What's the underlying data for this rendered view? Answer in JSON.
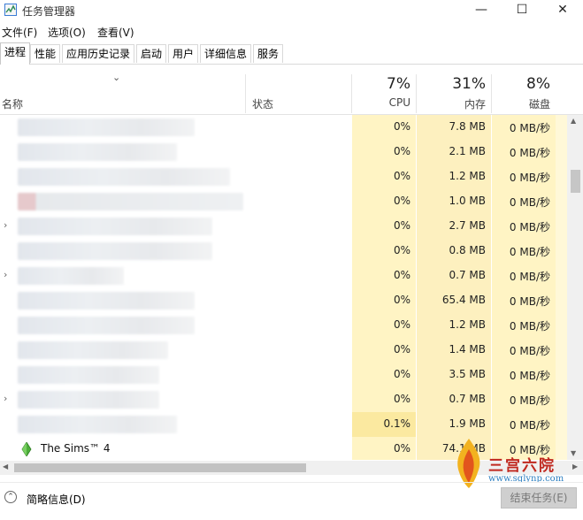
{
  "window": {
    "title": "任务管理器",
    "icon": "task-manager-icon"
  },
  "window_controls": {
    "minimize": "—",
    "maximize": "☐",
    "close": "✕"
  },
  "menu": [
    "文件(F)",
    "选项(O)",
    "查看(V)"
  ],
  "tabs": [
    "进程",
    "性能",
    "应用历史记录",
    "启动",
    "用户",
    "详细信息",
    "服务"
  ],
  "active_tab": "进程",
  "columns": {
    "name": "名称",
    "status": "状态",
    "cpu": {
      "pct": "7%",
      "label": "CPU"
    },
    "memory": {
      "pct": "31%",
      "label": "内存"
    },
    "disk": {
      "pct": "8%",
      "label": "磁盘"
    }
  },
  "rows": [
    {
      "name": "",
      "cpu": "0%",
      "mem": "7.8 MB",
      "disk": "0 MB/秒",
      "expander": false
    },
    {
      "name": "",
      "cpu": "0%",
      "mem": "2.1 MB",
      "disk": "0 MB/秒",
      "expander": false
    },
    {
      "name": "",
      "cpu": "0%",
      "mem": "1.2 MB",
      "disk": "0 MB/秒",
      "expander": false
    },
    {
      "name": "",
      "cpu": "0%",
      "mem": "1.0 MB",
      "disk": "0 MB/秒",
      "expander": false
    },
    {
      "name": "",
      "cpu": "0%",
      "mem": "2.7 MB",
      "disk": "0 MB/秒",
      "expander": true
    },
    {
      "name": "",
      "cpu": "0%",
      "mem": "0.8 MB",
      "disk": "0 MB/秒",
      "expander": false
    },
    {
      "name": "",
      "cpu": "0%",
      "mem": "0.7 MB",
      "disk": "0 MB/秒",
      "expander": true
    },
    {
      "name": "",
      "cpu": "0%",
      "mem": "65.4 MB",
      "disk": "0 MB/秒",
      "expander": false
    },
    {
      "name": "",
      "cpu": "0%",
      "mem": "1.2 MB",
      "disk": "0 MB/秒",
      "expander": false
    },
    {
      "name": "",
      "cpu": "0%",
      "mem": "1.4 MB",
      "disk": "0 MB/秒",
      "expander": false
    },
    {
      "name": "",
      "cpu": "0%",
      "mem": "3.5 MB",
      "disk": "0 MB/秒",
      "expander": false
    },
    {
      "name": "",
      "cpu": "0%",
      "mem": "0.7 MB",
      "disk": "0 MB/秒",
      "expander": true
    },
    {
      "name": "",
      "cpu": "0.1%",
      "mem": "1.9 MB",
      "disk": "0 MB/秒",
      "expander": false
    },
    {
      "name": "The Sims™ 4",
      "cpu": "0%",
      "mem": "74.1 MB",
      "disk": "0 MB/秒",
      "expander": false,
      "icon": "sims-plumbob-icon"
    }
  ],
  "footer": {
    "brief_label": "简略信息(D)",
    "end_task_label": "结束任务(E)"
  },
  "watermark": {
    "text": "三宫六院",
    "url": "www.sglynp.com"
  },
  "colors": {
    "cpu_heat": "#fff4c4",
    "cpu_heat_active": "#fbe9a0",
    "mem_heat": "#fdf0bf",
    "disk_heat": "#fff4c4"
  }
}
